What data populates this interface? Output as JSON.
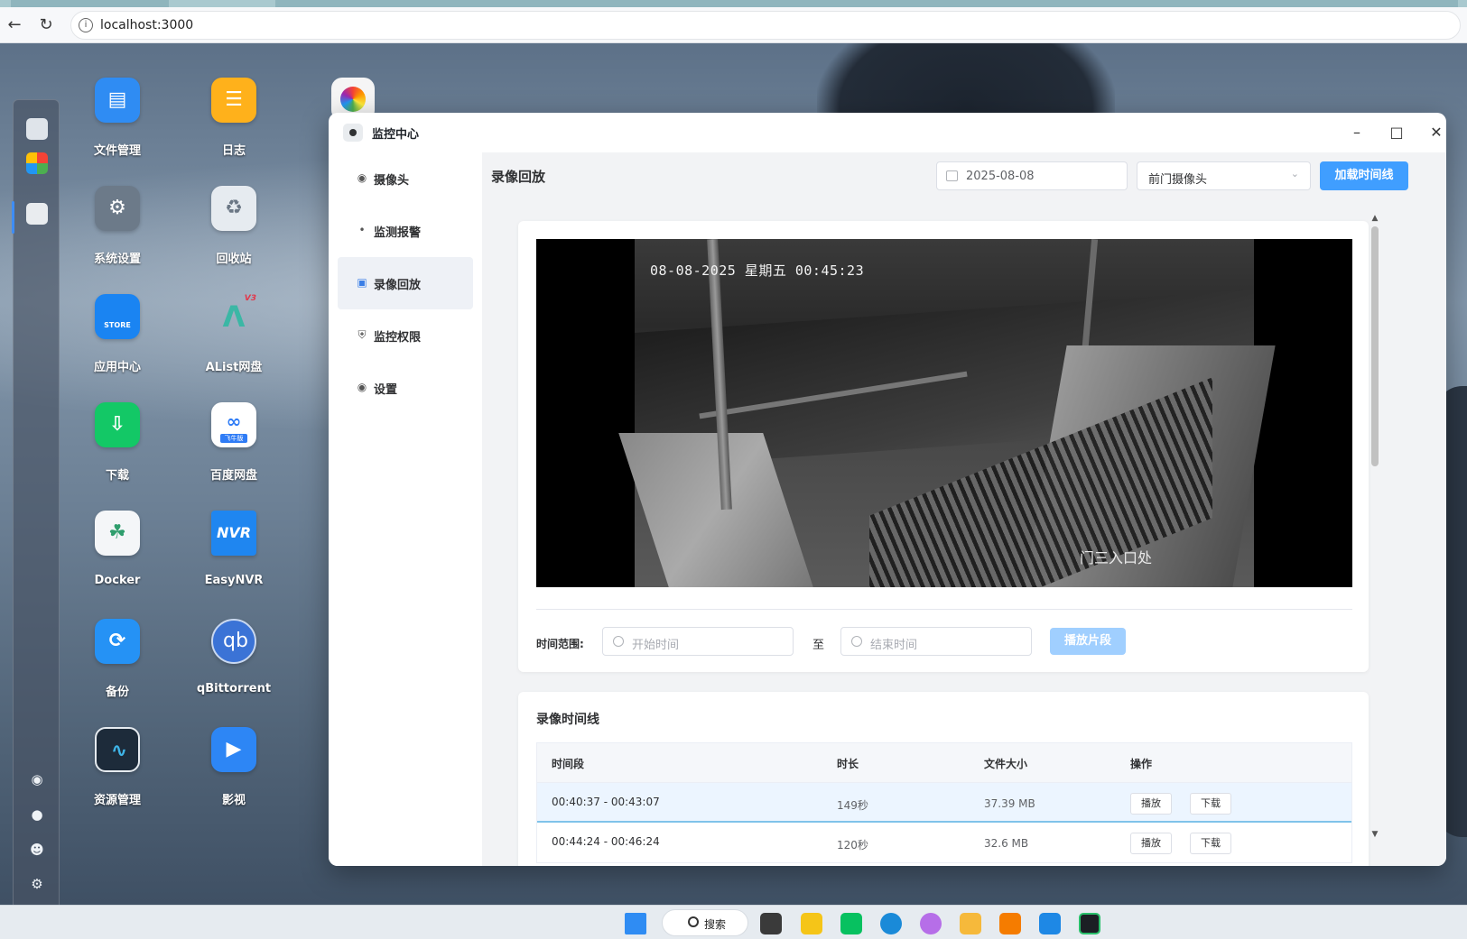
{
  "browser": {
    "url": "localhost:3000"
  },
  "desktop": {
    "icons": [
      {
        "label": "文件管理",
        "icon": "folder-icon",
        "color": "#2f8cf3"
      },
      {
        "label": "日志",
        "icon": "notes-icon",
        "color": "#ffb11b"
      },
      {
        "label": "系统设置",
        "icon": "gear-icon",
        "color": "#6c7a89"
      },
      {
        "label": "回收站",
        "icon": "recycle-icon",
        "color": "#e6ebf0"
      },
      {
        "label": "应用中心",
        "icon": "store-icon",
        "color": "#1a84f2"
      },
      {
        "label": "AList网盘",
        "icon": "alist-icon",
        "color": "#3b4f63"
      },
      {
        "label": "下载",
        "icon": "download-icon",
        "color": "#13c866"
      },
      {
        "label": "百度网盘",
        "icon": "baidu-cloud-icon",
        "color": "#ffffff"
      },
      {
        "label": "Docker",
        "icon": "docker-icon",
        "color": "#f4f6f8"
      },
      {
        "label": "EasyNVR",
        "icon": "easynvr-icon",
        "color": "#1f86f0"
      },
      {
        "label": "备份",
        "icon": "backup-icon",
        "color": "#2592f5"
      },
      {
        "label": "qBittorrent",
        "icon": "qbittorrent-icon",
        "color": "#3b73d6"
      },
      {
        "label": "资源管理",
        "icon": "resource-monitor-icon",
        "color": "#1d2b3a"
      },
      {
        "label": "影视",
        "icon": "video-icon",
        "color": "#2d86f5"
      }
    ],
    "store_text": "STORE",
    "baidu_text": "飞牛版",
    "alist_badge": "V3",
    "easynvr_text": "NVR",
    "qb_text": "qb"
  },
  "window": {
    "title": "监控中心",
    "nav": [
      {
        "label": "摄像头",
        "icon": "camera-icon"
      },
      {
        "label": "监测报警",
        "icon": "alarm-signal-icon"
      },
      {
        "label": "录像回放",
        "icon": "playback-icon",
        "active": true
      },
      {
        "label": "监控权限",
        "icon": "shield-icon"
      },
      {
        "label": "设置",
        "icon": "settings-icon"
      }
    ],
    "page_title": "录像回放",
    "date_value": "2025-08-08",
    "camera_value": "前门摄像头",
    "load_button": "加载时间线",
    "video": {
      "timestamp": "08-08-2025 星期五 00:45:23",
      "camera_label": "门三入口处"
    },
    "range_label": "时间范围:",
    "start_placeholder": "开始时间",
    "to_label": "至",
    "end_placeholder": "结束时间",
    "play_segment": "播放片段",
    "timeline_title": "录像时间线",
    "table": {
      "headers": [
        "时间段",
        "时长",
        "文件大小",
        "操作"
      ],
      "rows": [
        {
          "period": "00:40:37 - 00:43:07",
          "duration": "149秒",
          "size": "37.39 MB",
          "play": "播放",
          "download": "下载"
        },
        {
          "period": "00:44:24 - 00:46:24",
          "duration": "120秒",
          "size": "32.6 MB",
          "play": "播放",
          "download": "下载"
        }
      ]
    }
  },
  "taskbar": {
    "search_label": "搜索"
  },
  "colors": {
    "primary": "#409eff",
    "primary_light": "#a0cfff",
    "nav_active_bg": "#eef1f6"
  }
}
